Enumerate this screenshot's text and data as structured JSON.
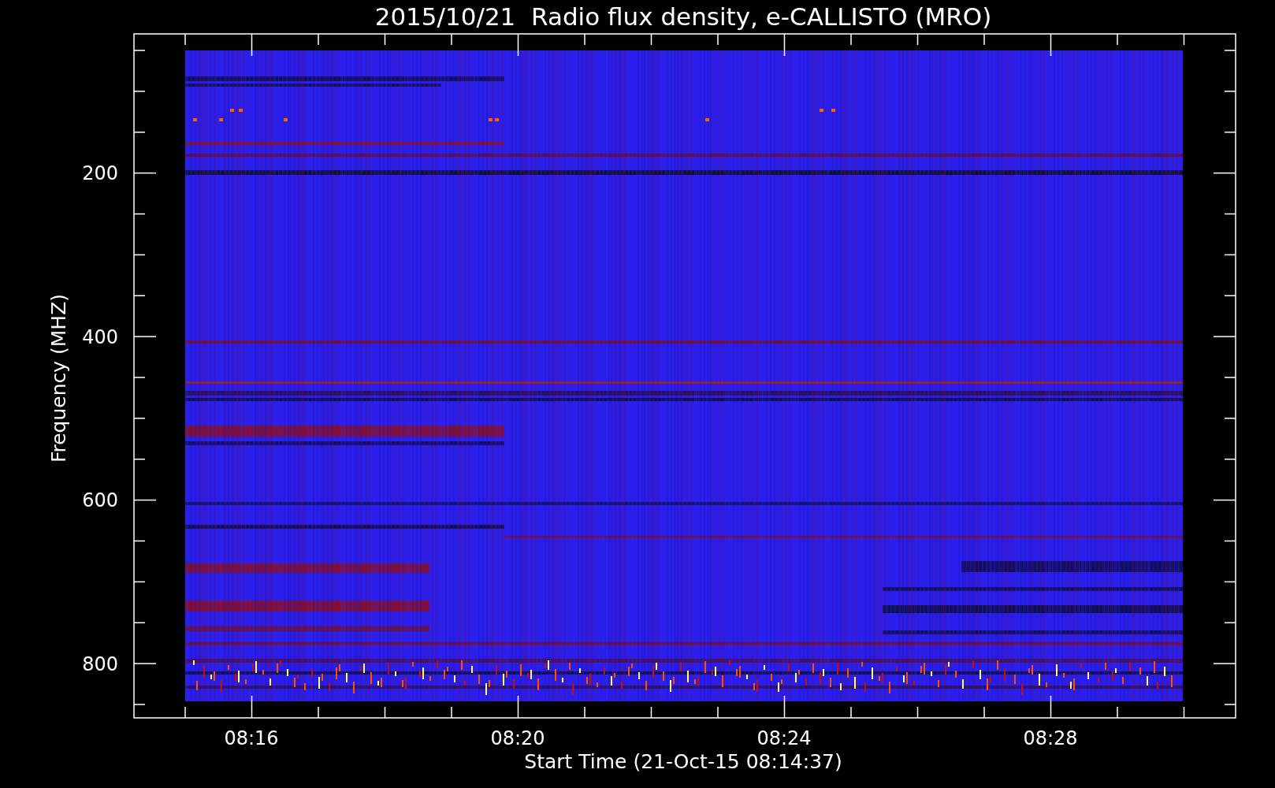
{
  "title": "2015/10/21  Radio flux density, e-CALLISTO (MRO)",
  "y_axis": {
    "label": "Frequency (MHZ)",
    "ticks": [
      "200",
      "400",
      "600",
      "800"
    ]
  },
  "x_axis": {
    "label": "Start Time (21-Oct-15 08:14:37)",
    "ticks": [
      "08:16",
      "08:20",
      "08:24",
      "08:28"
    ]
  }
}
